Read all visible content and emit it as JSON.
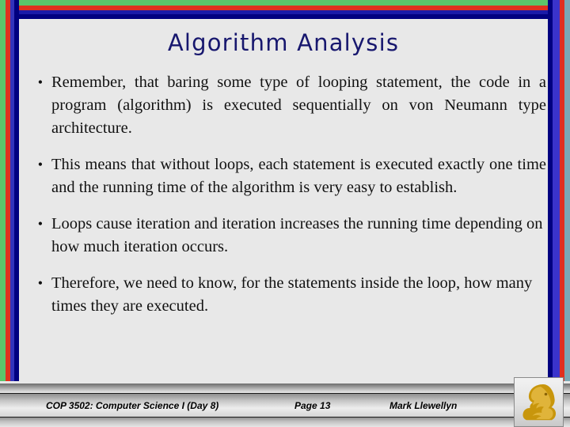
{
  "slide": {
    "title": "Algorithm Analysis",
    "background_color": "#e8e8e8",
    "title_color": "#17176e"
  },
  "frame": {
    "colors": {
      "green": "#5bc46a",
      "red": "#e0301e",
      "blue": "#3333bb",
      "navy": "#000080",
      "teal_right": "#79a8b4"
    }
  },
  "bullets": [
    {
      "marker": "•",
      "text": "Remember, that baring some type of looping statement, the code in a program (algorithm) is executed sequentially on von Neumann type architecture."
    },
    {
      "marker": "•",
      "text": "This means that without loops, each statement is executed exactly one time and the running time of the algorithm is very easy to establish."
    },
    {
      "marker": "•",
      "text": "Loops cause iteration and iteration increases the running time depending on how much iteration occurs."
    },
    {
      "marker": "•",
      "text": "Therefore, we need to know, for the statements inside the loop, how many times they are executed."
    }
  ],
  "footer": {
    "course": "COP 3502: Computer Science I  (Day 8)",
    "page": "Page 13",
    "author": "Mark Llewellyn",
    "logo_name": "ucf-pegasus-logo",
    "logo_color": "#c8960c"
  }
}
